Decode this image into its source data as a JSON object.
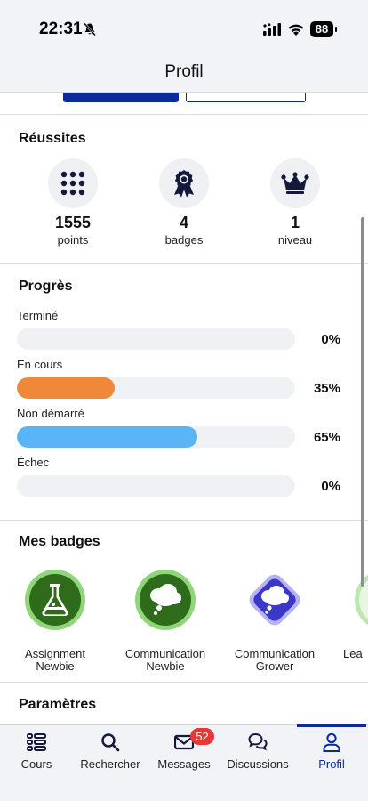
{
  "status_bar": {
    "time": "22:31",
    "battery": "88"
  },
  "nav": {
    "title": "Profil"
  },
  "achievements": {
    "title": "Réussites",
    "items": [
      {
        "value": "1555",
        "label": "points",
        "icon": "grid-dots-icon"
      },
      {
        "value": "4",
        "label": "badges",
        "icon": "award-ribbon-icon"
      },
      {
        "value": "1",
        "label": "niveau",
        "icon": "crown-icon"
      }
    ]
  },
  "progress": {
    "title": "Progrès",
    "items": [
      {
        "label": "Terminé",
        "percent_text": "0%",
        "fraction": 0.0,
        "color": "#f0f1f4"
      },
      {
        "label": "En cours",
        "percent_text": "35%",
        "fraction": 0.35,
        "color": "#f0883a"
      },
      {
        "label": "Non démarré",
        "percent_text": "65%",
        "fraction": 0.65,
        "color": "#5ab4f8"
      },
      {
        "label": "Échec",
        "percent_text": "0%",
        "fraction": 0.0,
        "color": "#f0f1f4"
      }
    ]
  },
  "badges": {
    "title": "Mes badges",
    "items": [
      {
        "label_line1": "Assignment",
        "label_line2": "Newbie",
        "icon": "flask-icon",
        "color": "#2e6b1a"
      },
      {
        "label_line1": "Communication",
        "label_line2": "Newbie",
        "icon": "thought-cloud-icon",
        "color": "#2e6b1a"
      },
      {
        "label_line1": "Communication",
        "label_line2": "Grower",
        "icon": "thought-cloud-icon",
        "color": "#3b37c8"
      },
      {
        "label_line1": "Lea",
        "label_line2": "",
        "icon": "badge-icon",
        "color": "#2e6b1a"
      }
    ]
  },
  "settings": {
    "title": "Paramètres"
  },
  "tabs": [
    {
      "label": "Cours",
      "icon": "list-icon"
    },
    {
      "label": "Rechercher",
      "icon": "search-icon"
    },
    {
      "label": "Messages",
      "icon": "envelope-icon",
      "badge": "52"
    },
    {
      "label": "Discussions",
      "icon": "chat-bubbles-icon"
    },
    {
      "label": "Profil",
      "icon": "person-icon",
      "active": true
    }
  ],
  "colors": {
    "accent": "#0b2a9c",
    "orange": "#f0883a",
    "blue": "#5ab4f8",
    "badge_red": "#e53935"
  }
}
